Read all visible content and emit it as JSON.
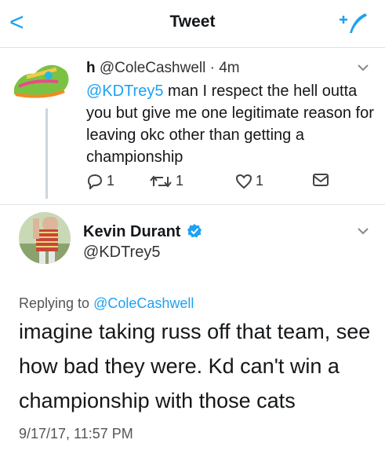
{
  "nav": {
    "back_glyph": "<",
    "title": "Tweet",
    "compose_icon": "compose-tweet-icon"
  },
  "parent_tweet": {
    "name": "h",
    "handle_time": "@ColeCashwell · 4m",
    "mention": "@KDTrey5",
    "text": " man I respect the hell outta you but give me one legitimate reason for leaving okc other than getting a championship",
    "reply_count": "1",
    "retweet_count": "1",
    "like_count": "1"
  },
  "main_tweet": {
    "name": "Kevin Durant",
    "handle": "@KDTrey5",
    "replying_prefix": "Replying to ",
    "replying_handle": "@ColeCashwell",
    "text": "imagine taking russ off that team, see how bad they were. Kd can't win a championship with those cats",
    "timestamp": "9/17/17, 11:57 PM"
  },
  "colors": {
    "accent": "#1da1f2",
    "text": "#14171a",
    "secondary": "#555555"
  }
}
